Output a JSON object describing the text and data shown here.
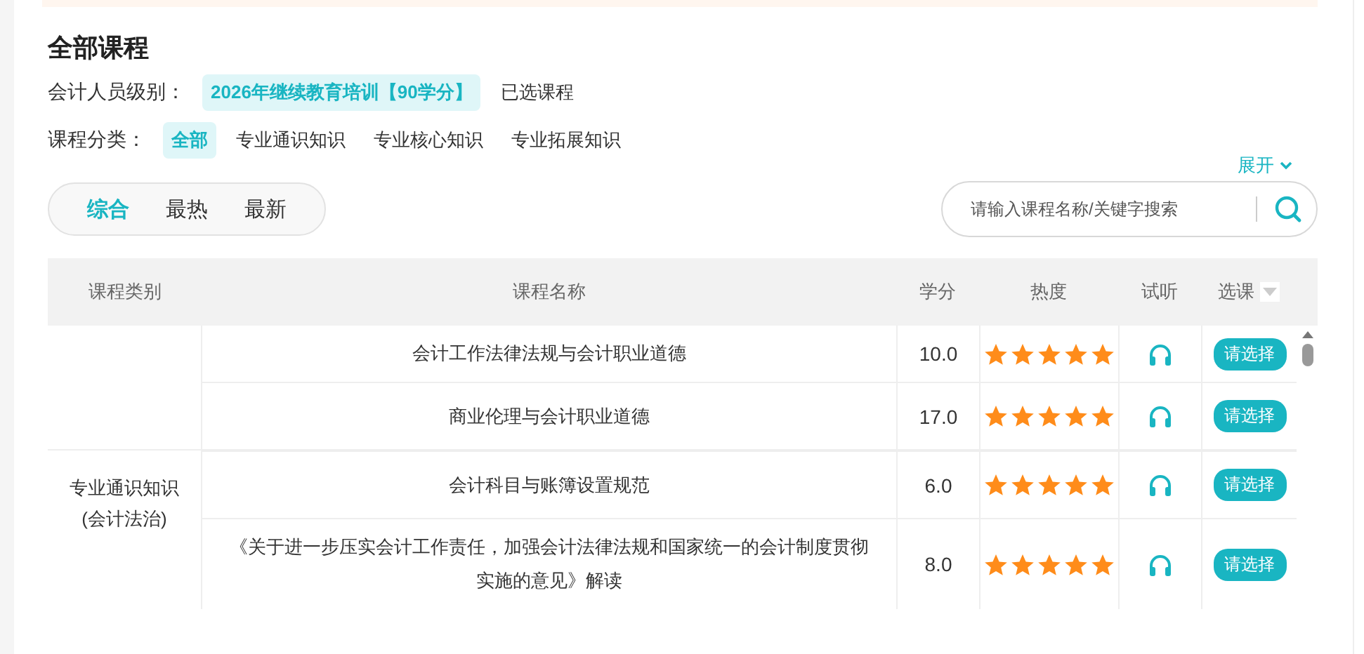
{
  "title": "全部课程",
  "level_filter": {
    "label": "会计人员级别：",
    "options": [
      {
        "label": "2026年继续教育培训【90学分】",
        "selected": true
      },
      {
        "label": "已选课程",
        "selected": false
      }
    ]
  },
  "category_filter": {
    "label": "课程分类：",
    "options": [
      {
        "label": "全部",
        "selected": true
      },
      {
        "label": "专业通识知识",
        "selected": false
      },
      {
        "label": "专业核心知识",
        "selected": false
      },
      {
        "label": "专业拓展知识",
        "selected": false
      }
    ],
    "expand": "展开"
  },
  "sort_tabs": [
    {
      "label": "综合",
      "selected": true
    },
    {
      "label": "最热",
      "selected": false
    },
    {
      "label": "最新",
      "selected": false
    }
  ],
  "search": {
    "placeholder": "请输入课程名称/关键字搜索"
  },
  "table": {
    "columns": [
      "课程类别",
      "课程名称",
      "学分",
      "热度",
      "试听",
      "选课"
    ],
    "groups": [
      {
        "rows": [
          {
            "name": "会计工作法律法规与会计职业道德",
            "credits": "10.0",
            "stars": 5,
            "action": "请选择"
          },
          {
            "name": "商业伦理与会计职业道德",
            "credits": "17.0",
            "stars": 5,
            "action": "请选择"
          }
        ]
      },
      {
        "category": "专业通识知识(会计法治)",
        "rows": [
          {
            "name": "会计科目与账簿设置规范",
            "credits": "6.0",
            "stars": 5,
            "action": "请选择"
          },
          {
            "name": "《关于进一步压实会计工作责任，加强会计法律法规和国家统一的会计制度贯彻实施的意见》解读",
            "credits": "8.0",
            "stars": 5,
            "action": "请选择"
          }
        ]
      }
    ]
  }
}
